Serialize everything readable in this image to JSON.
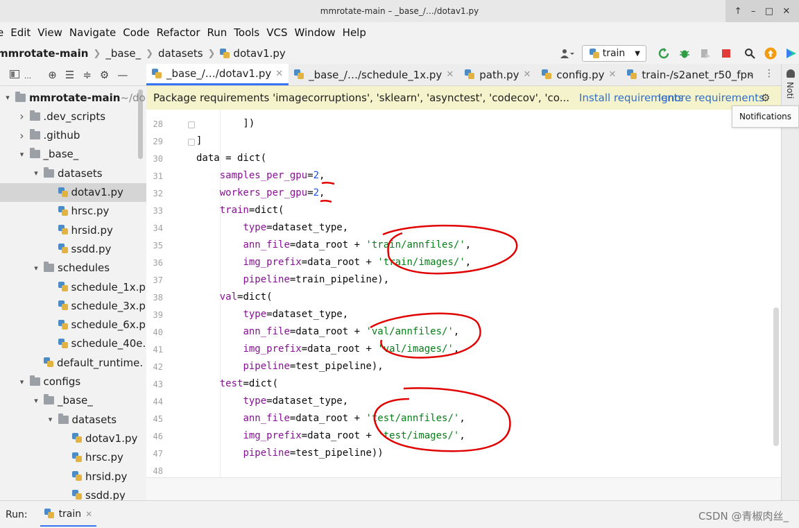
{
  "window": {
    "title": "mmrotate-main – _base_/…/dotav1.py",
    "controls": [
      "↑",
      "–",
      "□",
      "✕"
    ]
  },
  "menu": [
    "e",
    "Edit",
    "View",
    "Navigate",
    "Code",
    "Refactor",
    "Run",
    "Tools",
    "VCS",
    "Window",
    "Help"
  ],
  "breadcrumb": [
    "mmrotate-main",
    "_base_",
    "datasets",
    "dotav1.py"
  ],
  "run_config": {
    "label": "train"
  },
  "project_header": {
    "icons": [
      "layout-icon",
      "target-icon",
      "collapse-all-icon",
      "expand-all-icon",
      "gear-icon",
      "minimize-icon"
    ]
  },
  "project_tree": [
    {
      "label": "mmrotate-main",
      "suffix": " ~/do",
      "depth": 0,
      "type": "folder",
      "expanded": true,
      "bold": true
    },
    {
      "label": ".dev_scripts",
      "depth": 1,
      "type": "folder",
      "expanded": false
    },
    {
      "label": ".github",
      "depth": 1,
      "type": "folder",
      "expanded": false
    },
    {
      "label": "_base_",
      "depth": 1,
      "type": "folder",
      "expanded": true
    },
    {
      "label": "datasets",
      "depth": 2,
      "type": "folder",
      "expanded": true
    },
    {
      "label": "dotav1.py",
      "depth": 3,
      "type": "file",
      "selected": true
    },
    {
      "label": "hrsc.py",
      "depth": 3,
      "type": "file"
    },
    {
      "label": "hrsid.py",
      "depth": 3,
      "type": "file"
    },
    {
      "label": "ssdd.py",
      "depth": 3,
      "type": "file"
    },
    {
      "label": "schedules",
      "depth": 2,
      "type": "folder",
      "expanded": true
    },
    {
      "label": "schedule_1x.p",
      "depth": 3,
      "type": "file"
    },
    {
      "label": "schedule_3x.p",
      "depth": 3,
      "type": "file"
    },
    {
      "label": "schedule_6x.p",
      "depth": 3,
      "type": "file"
    },
    {
      "label": "schedule_40e.",
      "depth": 3,
      "type": "file"
    },
    {
      "label": "default_runtime.",
      "depth": 2,
      "type": "file"
    },
    {
      "label": "configs",
      "depth": 1,
      "type": "folder",
      "expanded": true
    },
    {
      "label": "_base_",
      "depth": 2,
      "type": "folder",
      "expanded": true
    },
    {
      "label": "datasets",
      "depth": 3,
      "type": "folder",
      "expanded": true
    },
    {
      "label": "dotav1.py",
      "depth": 4,
      "type": "file"
    },
    {
      "label": "hrsc.py",
      "depth": 4,
      "type": "file"
    },
    {
      "label": "hrsid.py",
      "depth": 4,
      "type": "file"
    },
    {
      "label": "ssdd.py",
      "depth": 4,
      "type": "file"
    }
  ],
  "tabs": [
    {
      "label": "_base_/…/dotav1.py",
      "active": true,
      "closable": true
    },
    {
      "label": "_base_/…/schedule_1x.py",
      "closable": true
    },
    {
      "label": "path.py",
      "closable": true
    },
    {
      "label": "config.py",
      "closable": true
    },
    {
      "label": "train-/s2anet_r50_fpn",
      "closable": false
    }
  ],
  "banner": {
    "message": "Package requirements 'imagecorruptions', 'sklearn', 'asynctest', 'codecov', 'co...",
    "install": "Install requirements",
    "ignore": "Ignore requirements"
  },
  "code_lines": [
    {
      "n": "28",
      "tokens": [
        [
          "p",
          "        ])"
        ]
      ]
    },
    {
      "n": "29",
      "tokens": [
        [
          "p",
          "]"
        ]
      ]
    },
    {
      "n": "30",
      "tokens": [
        [
          "p",
          "data = dict("
        ]
      ]
    },
    {
      "n": "31",
      "tokens": [
        [
          "p",
          "    "
        ],
        [
          "k",
          "samples_per_gpu"
        ],
        [
          "p",
          "="
        ],
        [
          "n",
          "2"
        ],
        [
          "p",
          ","
        ]
      ]
    },
    {
      "n": "32",
      "tokens": [
        [
          "p",
          "    "
        ],
        [
          "k",
          "workers_per_gpu"
        ],
        [
          "p",
          "="
        ],
        [
          "n",
          "2"
        ],
        [
          "p",
          ","
        ]
      ]
    },
    {
      "n": "33",
      "tokens": [
        [
          "p",
          "    "
        ],
        [
          "k",
          "train"
        ],
        [
          "p",
          "=dict("
        ]
      ]
    },
    {
      "n": "34",
      "tokens": [
        [
          "p",
          "        "
        ],
        [
          "k",
          "type"
        ],
        [
          "p",
          "=dataset_type,"
        ]
      ]
    },
    {
      "n": "35",
      "tokens": [
        [
          "p",
          "        "
        ],
        [
          "k",
          "ann_file"
        ],
        [
          "p",
          "=data_root + "
        ],
        [
          "s",
          "'train/annfiles/'"
        ],
        [
          "p",
          ","
        ]
      ]
    },
    {
      "n": "36",
      "tokens": [
        [
          "p",
          "        "
        ],
        [
          "k",
          "img_prefix"
        ],
        [
          "p",
          "=data_root + "
        ],
        [
          "s",
          "'train/images/'"
        ],
        [
          "p",
          ","
        ]
      ]
    },
    {
      "n": "37",
      "tokens": [
        [
          "p",
          "        "
        ],
        [
          "k",
          "pipeline"
        ],
        [
          "p",
          "=train_pipeline),"
        ]
      ]
    },
    {
      "n": "38",
      "tokens": [
        [
          "p",
          "    "
        ],
        [
          "k",
          "val"
        ],
        [
          "p",
          "=dict("
        ]
      ]
    },
    {
      "n": "39",
      "tokens": [
        [
          "p",
          "        "
        ],
        [
          "k",
          "type"
        ],
        [
          "p",
          "=dataset_type,"
        ]
      ]
    },
    {
      "n": "40",
      "tokens": [
        [
          "p",
          "        "
        ],
        [
          "k",
          "ann_file"
        ],
        [
          "p",
          "=data_root + "
        ],
        [
          "s",
          "'val/annfiles/'"
        ],
        [
          "p",
          ","
        ]
      ]
    },
    {
      "n": "41",
      "tokens": [
        [
          "p",
          "        "
        ],
        [
          "k",
          "img_prefix"
        ],
        [
          "p",
          "=data_root + "
        ],
        [
          "s",
          "'val/images/'"
        ],
        [
          "p",
          ","
        ]
      ]
    },
    {
      "n": "42",
      "tokens": [
        [
          "p",
          "        "
        ],
        [
          "k",
          "pipeline"
        ],
        [
          "p",
          "=test_pipeline),"
        ]
      ]
    },
    {
      "n": "43",
      "tokens": [
        [
          "p",
          "    "
        ],
        [
          "k",
          "test"
        ],
        [
          "p",
          "=dict("
        ]
      ]
    },
    {
      "n": "44",
      "tokens": [
        [
          "p",
          "        "
        ],
        [
          "k",
          "type"
        ],
        [
          "p",
          "=dataset_type,"
        ]
      ]
    },
    {
      "n": "45",
      "tokens": [
        [
          "p",
          "        "
        ],
        [
          "k",
          "ann_file"
        ],
        [
          "p",
          "=data_root + "
        ],
        [
          "s",
          "'test/annfiles/'"
        ],
        [
          "p",
          ","
        ]
      ]
    },
    {
      "n": "46",
      "tokens": [
        [
          "p",
          "        "
        ],
        [
          "k",
          "img_prefix"
        ],
        [
          "p",
          "=data_root + "
        ],
        [
          "s",
          "'test/images/'"
        ],
        [
          "p",
          ","
        ]
      ]
    },
    {
      "n": "47",
      "tokens": [
        [
          "p",
          "        "
        ],
        [
          "k",
          "pipeline"
        ],
        [
          "p",
          "=test_pipeline))"
        ]
      ]
    },
    {
      "n": "48",
      "tokens": []
    }
  ],
  "notifications": {
    "tooltip": "Notifications",
    "side_label": "Noti"
  },
  "run_panel": {
    "label": "Run:",
    "tab": "train"
  },
  "watermark": "CSDN @青椒肉丝_",
  "colors": {
    "accent": "#3574f0",
    "keyword": "#871094",
    "number": "#1750eb",
    "string": "#067d17",
    "annotation": "#e00000"
  }
}
